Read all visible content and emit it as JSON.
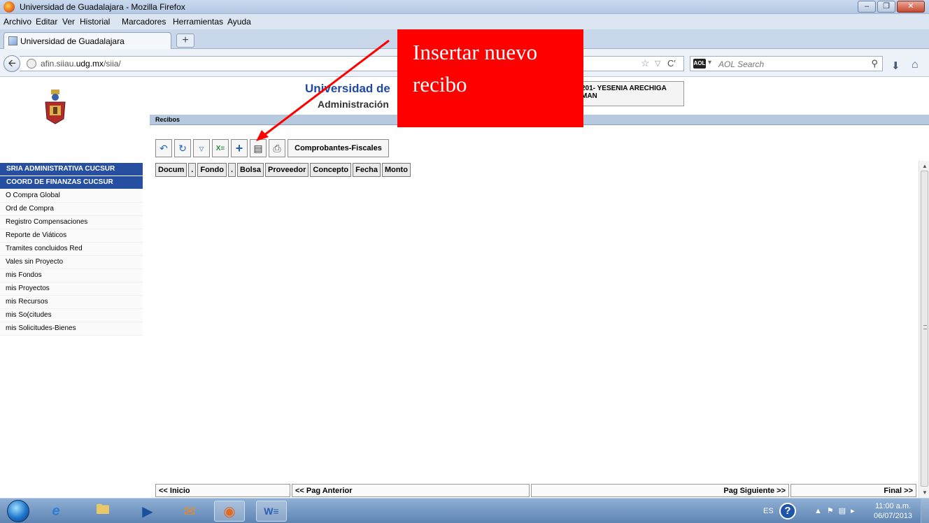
{
  "window": {
    "title": "Universidad de Guadalajara - Mozilla Firefox",
    "controls": [
      "minimize",
      "maximize",
      "close"
    ]
  },
  "menubar": [
    "Archivo",
    "Editar",
    "Ver",
    "Historial",
    "Marcadores",
    "Herramientas",
    "Ayuda"
  ],
  "tab": {
    "title": "Universidad de Guadalajara",
    "new_tab": "+"
  },
  "navbar": {
    "url_prefix": "afin.siiau.",
    "url_domain": "udg.mx",
    "url_suffix": "/siia/",
    "search_placeholder": "AOL Search",
    "search_engine_label": "AOL"
  },
  "header": {
    "university": "Universidad de",
    "subtitle": "Administración",
    "user_line1": "201- YESENIA ARECHIGA",
    "user_line2": "MAN"
  },
  "section": {
    "title": "Recibos"
  },
  "toolbar": {
    "fiscal_label": "Comprobantes-Fiscales"
  },
  "table": {
    "columns": [
      "Docum",
      ".",
      "Fondo",
      ".",
      "Bolsa",
      "Proveedor",
      "Concepto",
      "Fecha",
      "Monto"
    ]
  },
  "sidebar": {
    "groups": [
      "SRIA ADMINISTRATIVA CUCSUR",
      "COORD DE FINANZAS CUCSUR"
    ],
    "items": [
      "O Compra Global",
      "Ord de Compra",
      "Registro Compensaciones",
      "Reporte de Viáticos",
      "Tramites concluidos Red",
      "Vales sin Proyecto",
      "mis Fondos",
      "mis Proyectos",
      "mis Recursos",
      "mis So(citudes",
      "mis Solicitudes-Bienes"
    ]
  },
  "pager": {
    "first": "<< Inicio",
    "prev": "<< Pag Anterior",
    "next": "Pag Siguiente >>",
    "last": "Final >>"
  },
  "taskbar": {
    "language": "ES",
    "help": "?",
    "time": "11:00 a.m.",
    "date": "06/07/2013"
  },
  "callout": {
    "line1": "Insertar nuevo",
    "line2": "recibo",
    "color": "#ff0000"
  }
}
